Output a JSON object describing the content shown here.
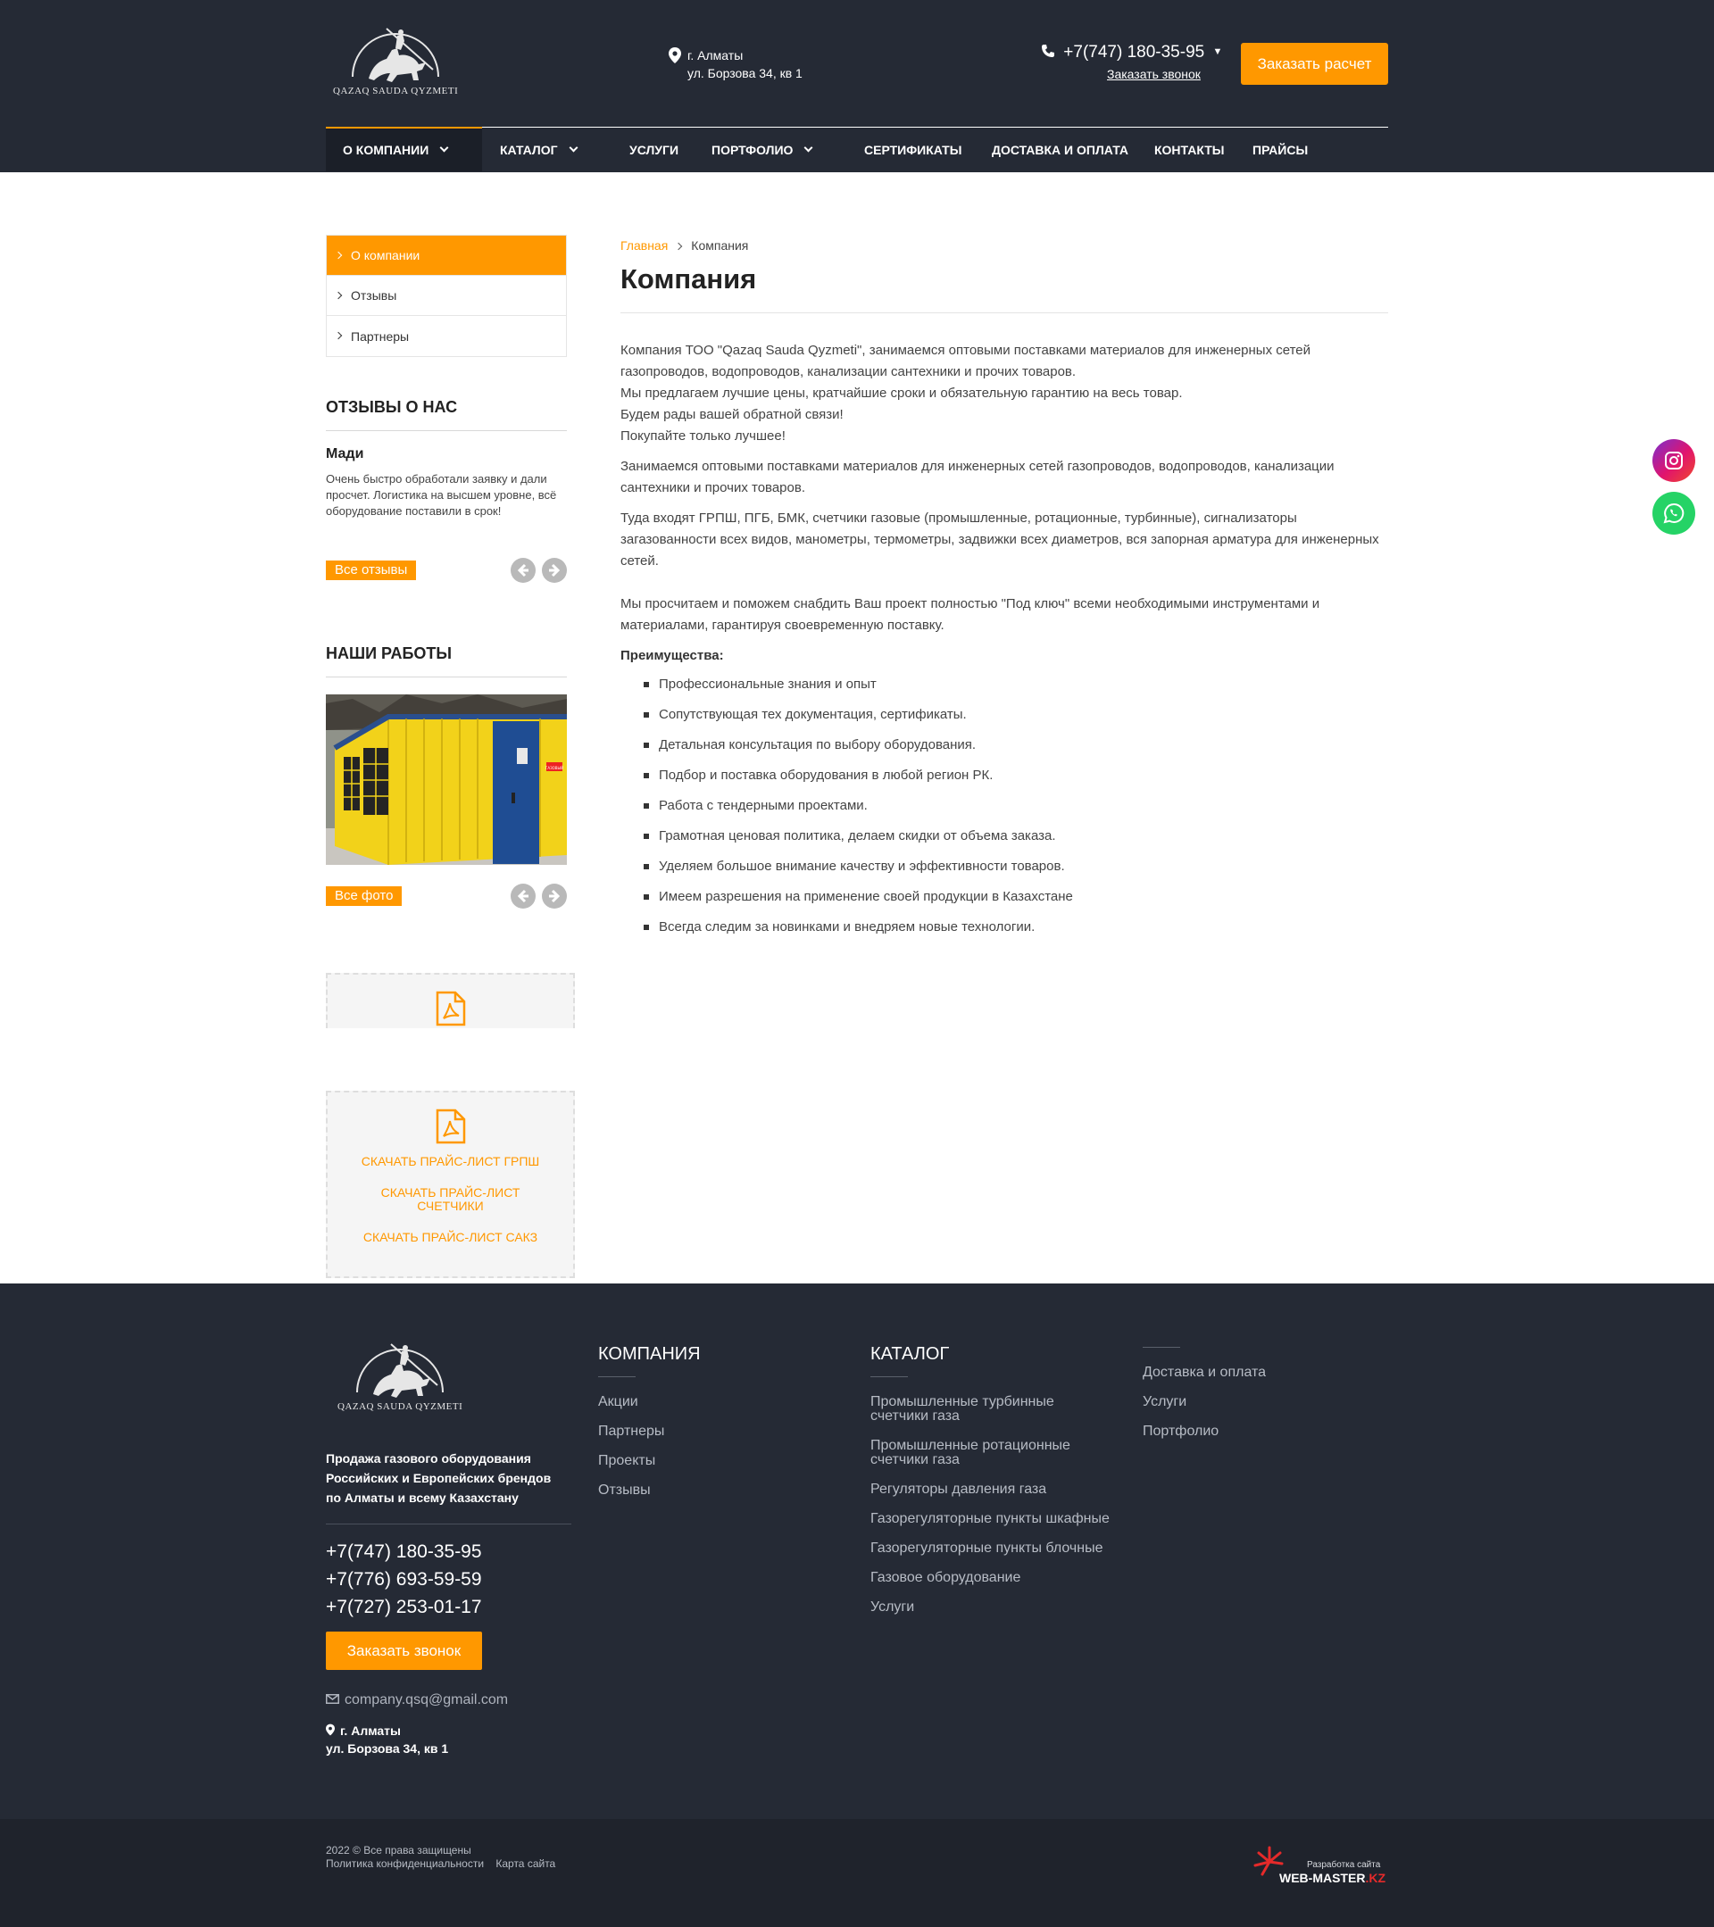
{
  "header": {
    "logo_text": "QAZAQ SAUDA QYZMETI",
    "address_city": "г. Алматы",
    "address_street": "ул. Борзова 34, кв 1",
    "phone": "+7(747) 180-35-95",
    "callback_label": "Заказать звонок",
    "order_label": "Заказать расчет"
  },
  "nav": {
    "items": [
      {
        "label": "О КОМПАНИИ"
      },
      {
        "label": "КАТАЛОГ"
      },
      {
        "label": "УСЛУГИ"
      },
      {
        "label": "ПОРТФОЛИО"
      },
      {
        "label": "СЕРТИФИКАТЫ"
      },
      {
        "label": "ДОСТАВКА И ОПЛАТА"
      },
      {
        "label": "КОНТАКТЫ"
      },
      {
        "label": "ПРАЙСЫ"
      }
    ]
  },
  "sidebar": {
    "menu": [
      {
        "label": "О компании"
      },
      {
        "label": "Отзывы"
      },
      {
        "label": "Партнеры"
      }
    ],
    "reviews_heading": "ОТЗЫВЫ О НАС",
    "review_name": "Мади",
    "review_text": "Очень быстро обработали заявку и дали просчет. Логистика на высшем уровне, всё оборудование поставили в срок!",
    "all_reviews_label": "Все отзывы",
    "works_heading": "НАШИ РАБОТЫ",
    "photo_sign": "ГАЗОВЫЙ",
    "all_photos_label": "Все фото",
    "price_links": [
      "СКАЧАТЬ ПРАЙС-ЛИСТ ГРПШ",
      "СКАЧАТЬ ПРАЙС-ЛИСТ СЧЕТЧИКИ",
      "СКАЧАТЬ ПРАЙС-ЛИСТ САКЗ"
    ]
  },
  "content": {
    "breadcrumb_home": "Главная",
    "breadcrumb_current": "Компания",
    "title": "Компания",
    "p1_lines": [
      "Компания ТОО \"Qazaq Sauda Qyzmeti\", занимаемся оптовыми поставками материалов для инженерных сетей",
      "газопроводов, водопроводов, канализации сантехники и прочих товаров.",
      "Мы предлагаем лучшие цены, кратчайшие сроки и обязательную гарантию на весь товар.",
      "Будем рады вашей обратной связи!",
      "Покупайте только лучшее!"
    ],
    "p2": "Занимаемся оптовыми поставками материалов для инженерных сетей газопроводов, водопроводов, канализации сантехники и прочих товаров.",
    "p3": "Туда входят  ГРПШ, ПГБ, БМК, счетчики газовые (промышленные, ротационные, турбинные), сигнализаторы загазованности всех видов, манометры, термометры, задвижки всех диаметров, вся запорная арматура для инженерных сетей.",
    "p4": "Мы просчитаем и поможем снабдить Ваш проект полностью \"Под ключ\" всеми необходимыми инструментами и материалами, гарантируя своевременную поставку.",
    "advantages_heading": "Преимущества:",
    "advantages": [
      "Профессиональные знания и опыт",
      "Сопутствующая тех документация, сертификаты.",
      "Детальная консультация по выбору оборудования.",
      "Подбор и поставка оборудования в любой регион РК.",
      "Работа с тендерными проектами.",
      "Грамотная ценовая политика, делаем скидки от объема заказа.",
      "Уделяем большое внимание качеству и эффективности товаров.",
      "Имеем разрешения на применение своей продукции в Казахстане",
      "Всегда следим за новинками и внедряем новые технологии."
    ]
  },
  "footer": {
    "logo_text": "QAZAQ SAUDA QYZMETI",
    "description": "Продажа газового оборудования Российских и Европейских брендов по Алматы и всему Казахстану",
    "phones": [
      "+7(747) 180-35-95",
      "+7(776) 693-59-59",
      "+7(727) 253-01-17"
    ],
    "callback_label": "Заказать звонок",
    "email": "company.qsq@gmail.com",
    "address_city": "г. Алматы",
    "address_street": "ул. Борзова 34, кв 1",
    "company_heading": "КОМПАНИЯ",
    "company_links": [
      "Акции",
      "Партнеры",
      "Проекты",
      "Отзывы"
    ],
    "catalog_heading": "КАТАЛОГ",
    "catalog_links": [
      "Промышленные турбинные счетчики газа",
      "Промышленные ротационные счетчики газа",
      "Регуляторы давления газа",
      "Газорегуляторные пункты шкафные",
      "Газорегуляторные пункты блочные",
      "Газовое оборудование",
      "Услуги"
    ],
    "extra_links": [
      "Доставка и оплата",
      "Услуги",
      "Портфолио"
    ],
    "copyright": "2022 © Все права защищены",
    "privacy": "Политика конфиденциальности",
    "sitemap": "Карта сайта",
    "dev_caption": "Разработка сайта",
    "dev_brand": "WEB-MASTER",
    "dev_tld": ".KZ"
  },
  "colors": {
    "accent": "#ff9800",
    "header_bg": "#252a35",
    "instagram": "#d6197a",
    "whatsapp": "#25d366"
  }
}
